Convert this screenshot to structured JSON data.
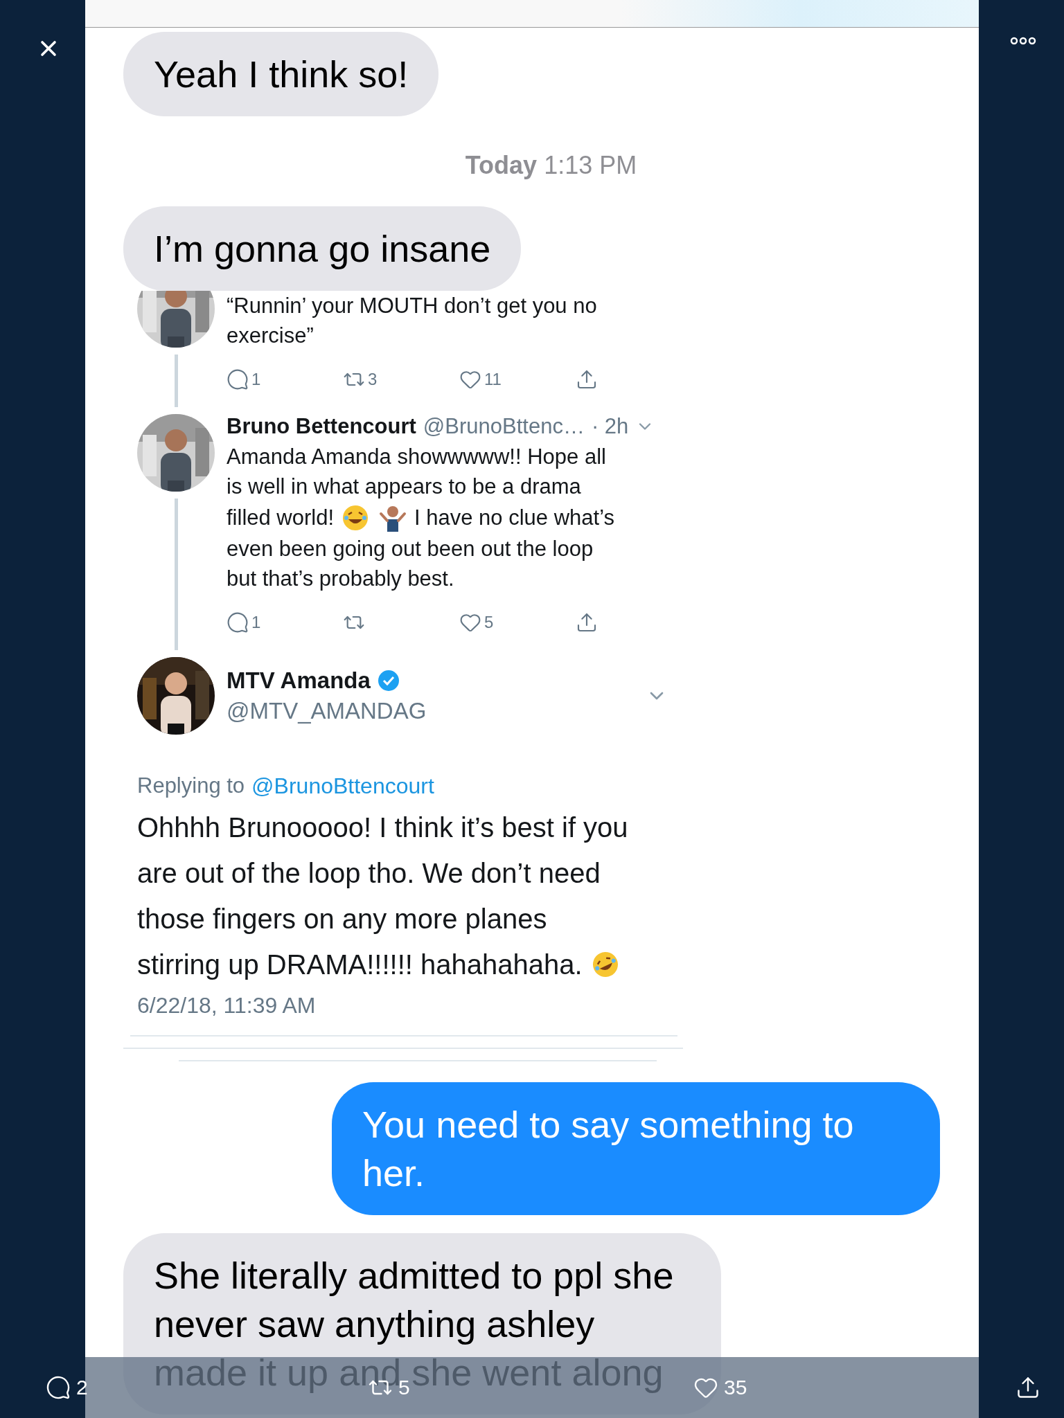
{
  "messages": [
    {
      "kind": "received",
      "text": "Yeah I think so!"
    },
    {
      "kind": "timestamp",
      "day": "Today",
      "time": "1:13 PM"
    },
    {
      "kind": "received",
      "text": "I’m gonna go insane"
    },
    {
      "kind": "tweet_screenshot",
      "thread": [
        {
          "text": "“Runnin’ your MOUTH don’t get you no exercise”",
          "actions": [
            {
              "kind": "reply",
              "count": "1"
            },
            {
              "kind": "retweet",
              "count": "3"
            },
            {
              "kind": "like",
              "count": "11"
            },
            {
              "kind": "share"
            }
          ]
        },
        {
          "name": "Bruno Bettencourt",
          "handle": "@BrunoBttenc…",
          "time": "· 2h",
          "text_lines": [
            "Amanda Amanda showwwww!! Hope all",
            "is well in what appears to be a drama",
            "filled world!"
          ],
          "text_after_emoji_lines": [
            "I have no clue what’s",
            "even been going out been out the loop",
            "but that’s probably best."
          ],
          "actions": [
            {
              "kind": "reply",
              "count": "1"
            },
            {
              "kind": "retweet"
            },
            {
              "kind": "like",
              "count": "5"
            },
            {
              "kind": "share"
            }
          ]
        }
      ],
      "main": {
        "name": "MTV Amanda",
        "verified": true,
        "handle": "@MTV_AMANDAG",
        "replying_label": "Replying to",
        "replying_to": "@BrunoBttencourt",
        "text_lines": [
          "Ohhhh Brunooooo! I think it’s best if you",
          "are out of the loop tho. We don’t need",
          "those fingers on any more planes",
          "stirring up DRAMA!!!!!! hahahahaha."
        ],
        "date": "6/22/18, 11:39 AM"
      }
    },
    {
      "kind": "sent",
      "text": "You need to say something to her."
    },
    {
      "kind": "received",
      "text": "She literally admitted to ppl she never saw anything ashley made it up and she went along"
    }
  ],
  "toolbar": [
    {
      "kind": "reply",
      "count": "2"
    },
    {
      "kind": "retweet",
      "count": "5"
    },
    {
      "kind": "like",
      "count": "35"
    },
    {
      "kind": "share"
    }
  ]
}
